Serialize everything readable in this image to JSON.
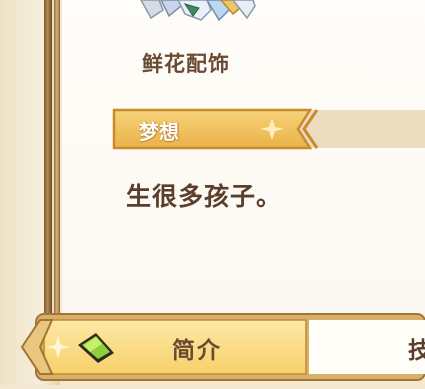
{
  "item": {
    "name": "鲜花配饰",
    "icon": "flower-accessory-icon"
  },
  "section": {
    "title": "梦想",
    "body": "生很多孩子。"
  },
  "tabs": [
    {
      "label": "简介",
      "icon": "leaf-icon",
      "active": true
    },
    {
      "label": "技",
      "active": false
    }
  ],
  "colors": {
    "text_brown": "#5a3d2b",
    "header_gold": "#f2c55a",
    "tab_active": "#fbe08a",
    "frame_brown": "#7b5a2f"
  }
}
